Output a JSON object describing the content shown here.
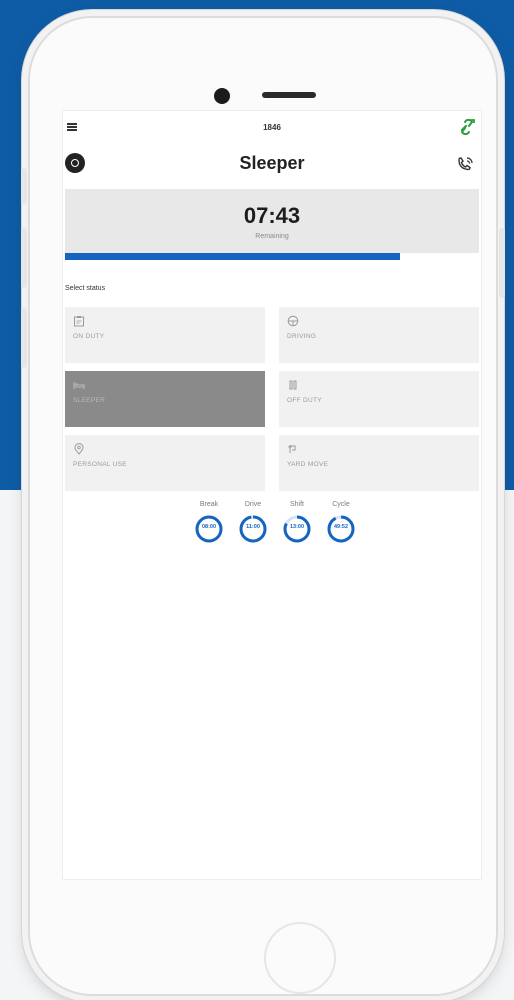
{
  "colors": {
    "background_top": "#0f5ca6",
    "accent": "#1565c0",
    "sync_icon": "#2e9e3c",
    "active_tile": "#8a8a8a"
  },
  "statusbar": {
    "time": "1846",
    "menu_icon": "hamburger-icon",
    "sync_icon": "sync-link-icon"
  },
  "appbar": {
    "title": "Sleeper",
    "avatar_icon": "truck-wheel-icon",
    "call_icon": "phone-call-icon"
  },
  "timer": {
    "value": "07:43",
    "caption": "Remaining",
    "progress_fraction": 0.81
  },
  "status_section": {
    "label": "Select status",
    "tiles": [
      {
        "label": "ON DUTY",
        "icon": "clipboard-icon",
        "active": false
      },
      {
        "label": "DRIVING",
        "icon": "steering-wheel-icon",
        "active": false
      },
      {
        "label": "SLEEPER",
        "icon": "bed-icon",
        "active": true
      },
      {
        "label": "OFF DUTY",
        "icon": "pause-icon",
        "active": false
      },
      {
        "label": "PERSONAL USE",
        "icon": "location-pin-icon",
        "active": false
      },
      {
        "label": "YARD MOVE",
        "icon": "route-icon",
        "active": false
      }
    ]
  },
  "clocks": [
    {
      "label": "Break",
      "value": "08:00",
      "fraction": 1.0
    },
    {
      "label": "Drive",
      "value": "11:00",
      "fraction": 0.97
    },
    {
      "label": "Shift",
      "value": "13:00",
      "fraction": 0.82
    },
    {
      "label": "Cycle",
      "value": "49:52",
      "fraction": 0.92
    }
  ]
}
